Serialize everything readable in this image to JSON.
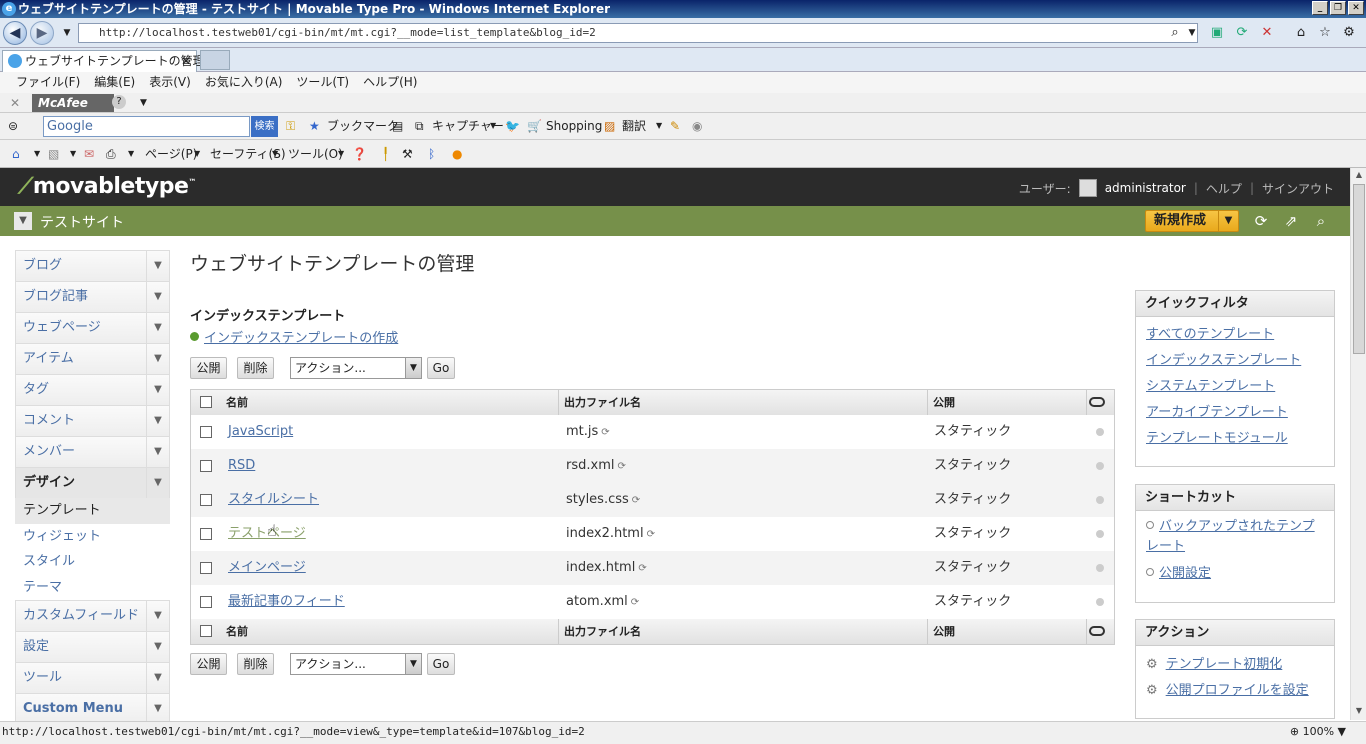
{
  "window": {
    "title": "ウェブサイトテンプレートの管理 - テストサイト | Movable Type Pro - Windows Internet Explorer"
  },
  "address": {
    "url": "http://localhost.testweb01/cgi-bin/mt/mt.cgi?__mode=list_template&blog_id=2"
  },
  "tab": {
    "label": "ウェブサイトテンプレートの管理..."
  },
  "menu": [
    "ファイル(F)",
    "編集(E)",
    "表示(V)",
    "お気に入り(A)",
    "ツール(T)",
    "ヘルプ(H)"
  ],
  "mcafee": {
    "label": "McAfee"
  },
  "googlebar": {
    "search_value": "Google",
    "search_button": "検索",
    "bookmark": "ブックマーク",
    "capture": "キャプチャー",
    "shopping": "Shopping",
    "translate": "翻訳"
  },
  "cmdbar": {
    "page": "ページ(P)",
    "safety": "セーフティ(S)",
    "tools": "ツール(O)"
  },
  "mt": {
    "logo": "movabletype",
    "user_label": "ユーザー:",
    "username": "administrator",
    "help": "ヘルプ",
    "signout": "サインアウト",
    "site_name": "テストサイト",
    "new_button": "新規作成"
  },
  "sidebar": {
    "items": [
      {
        "label": "ブログ"
      },
      {
        "label": "ブログ記事"
      },
      {
        "label": "ウェブページ"
      },
      {
        "label": "アイテム"
      },
      {
        "label": "タグ"
      },
      {
        "label": "コメント"
      },
      {
        "label": "メンバー"
      },
      {
        "label": "デザイン"
      }
    ],
    "design_sub": [
      {
        "label": "テンプレート"
      },
      {
        "label": "ウィジェット"
      },
      {
        "label": "スタイル"
      },
      {
        "label": "テーマ"
      }
    ],
    "items2": [
      {
        "label": "カスタムフィールド"
      },
      {
        "label": "設定"
      },
      {
        "label": "ツール"
      },
      {
        "label": "Custom Menu"
      }
    ]
  },
  "main": {
    "page_title": "ウェブサイトテンプレートの管理",
    "section_title": "インデックステンプレート",
    "create_link": "インデックステンプレートの作成",
    "publish_button": "公開",
    "delete_button": "削除",
    "action_select": "アクション...",
    "go_button": "Go",
    "columns": {
      "name": "名前",
      "output": "出力ファイル名",
      "publish": "公開"
    },
    "rows": [
      {
        "name": "JavaScript",
        "output": "mt.js",
        "publish": "スタティック"
      },
      {
        "name": "RSD",
        "output": "rsd.xml",
        "publish": "スタティック"
      },
      {
        "name": "スタイルシート",
        "output": "styles.css",
        "publish": "スタティック"
      },
      {
        "name": "テストページ",
        "output": "index2.html",
        "publish": "スタティック"
      },
      {
        "name": "メインページ",
        "output": "index.html",
        "publish": "スタティック"
      },
      {
        "name": "最新記事のフィード",
        "output": "atom.xml",
        "publish": "スタティック"
      }
    ]
  },
  "quickfilter": {
    "title": "クイックフィルタ",
    "links": [
      "すべてのテンプレート",
      "インデックステンプレート",
      "システムテンプレート",
      "アーカイブテンプレート",
      "テンプレートモジュール"
    ]
  },
  "shortcut": {
    "title": "ショートカット",
    "links": [
      "バックアップされたテンプレート",
      "公開設定"
    ]
  },
  "actions": {
    "title": "アクション",
    "links": [
      "テンプレート初期化",
      "公開プロファイルを設定"
    ]
  },
  "status": {
    "url": "http://localhost.testweb01/cgi-bin/mt/mt.cgi?__mode=view&_type=template&id=107&blog_id=2",
    "zoom": "100%"
  }
}
